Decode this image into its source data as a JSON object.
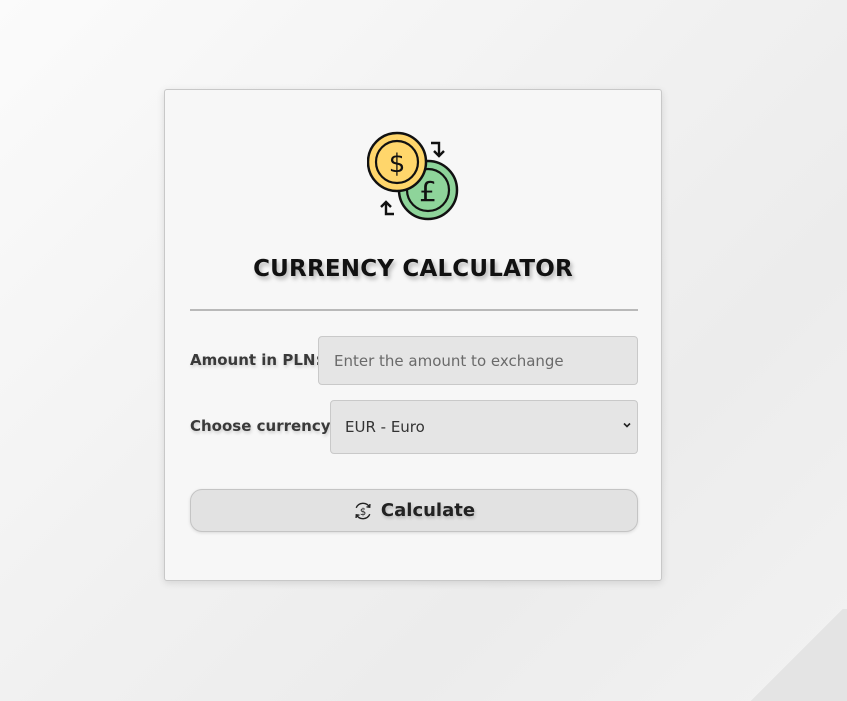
{
  "app": {
    "title": "CURRENCY CALCULATOR",
    "logo_icon": "currency-exchange-icon"
  },
  "form": {
    "amount_label": "Amount in PLN:",
    "amount_placeholder": "Enter the amount to exchange",
    "amount_value": "",
    "currency_label": "Choose currency:",
    "currency_selected": "EUR - Euro",
    "calculate_label": "Calculate",
    "calculate_icon": "dollar-refresh-icon"
  },
  "colors": {
    "coin_gold": "#FFD66B",
    "coin_green": "#8ED49A",
    "background": "#F3F3F3",
    "card": "#F7F7F7",
    "input_bg": "#E5E5E5"
  }
}
